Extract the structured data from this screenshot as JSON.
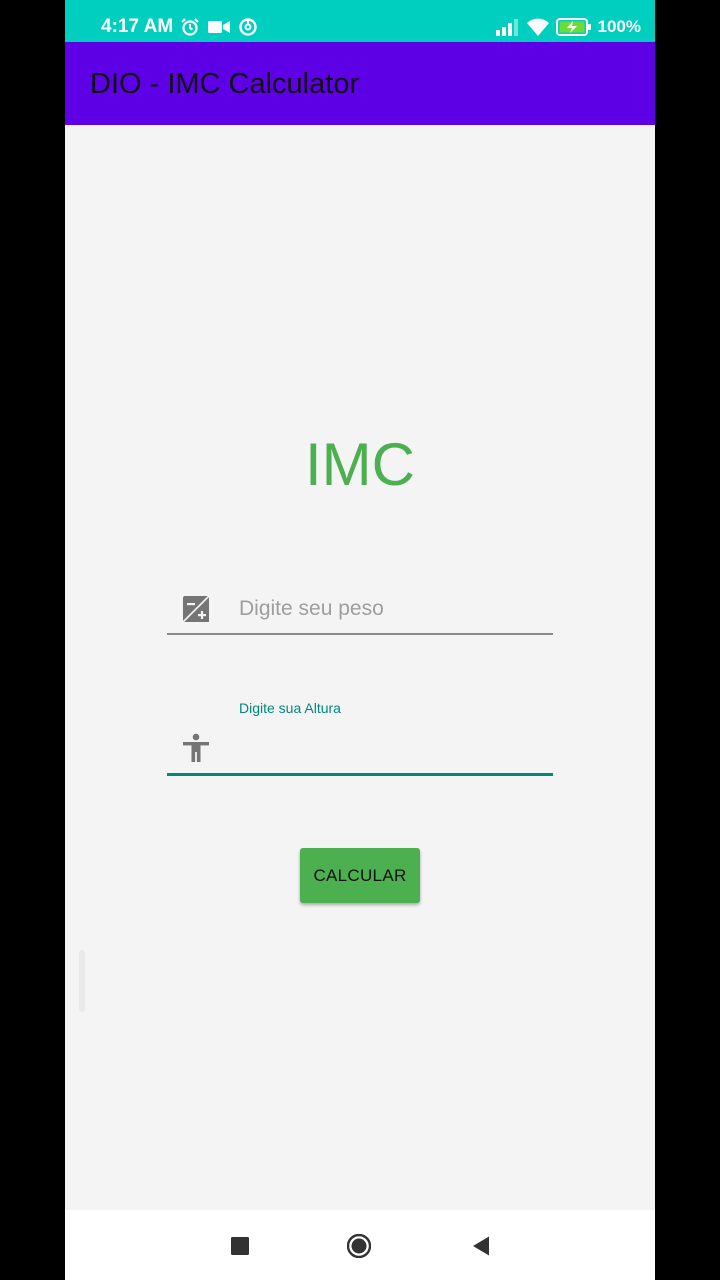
{
  "status_bar": {
    "time": "4:17 AM",
    "battery_percent": "100%",
    "left_icons": [
      "alarm-icon",
      "video-camera-icon",
      "sync-icon"
    ],
    "right_icons": [
      "signal-icon",
      "wifi-icon",
      "battery-charging-icon"
    ]
  },
  "app_bar": {
    "title": "DIO - IMC Calculator"
  },
  "main": {
    "heading": "IMC",
    "weight_field": {
      "placeholder": "Digite seu peso",
      "value": "",
      "icon": "weight-icon"
    },
    "height_field": {
      "label": "Digite sua Altura",
      "value": "",
      "icon": "person-icon"
    },
    "calculate_button": "CALCULAR"
  },
  "nav_bar": {
    "buttons": [
      "recents-button",
      "home-button",
      "back-button"
    ]
  },
  "colors": {
    "status_bar": "#00cfc0",
    "app_bar": "#5d00e6",
    "accent_green": "#4caf50",
    "focus_teal": "#00897b"
  }
}
